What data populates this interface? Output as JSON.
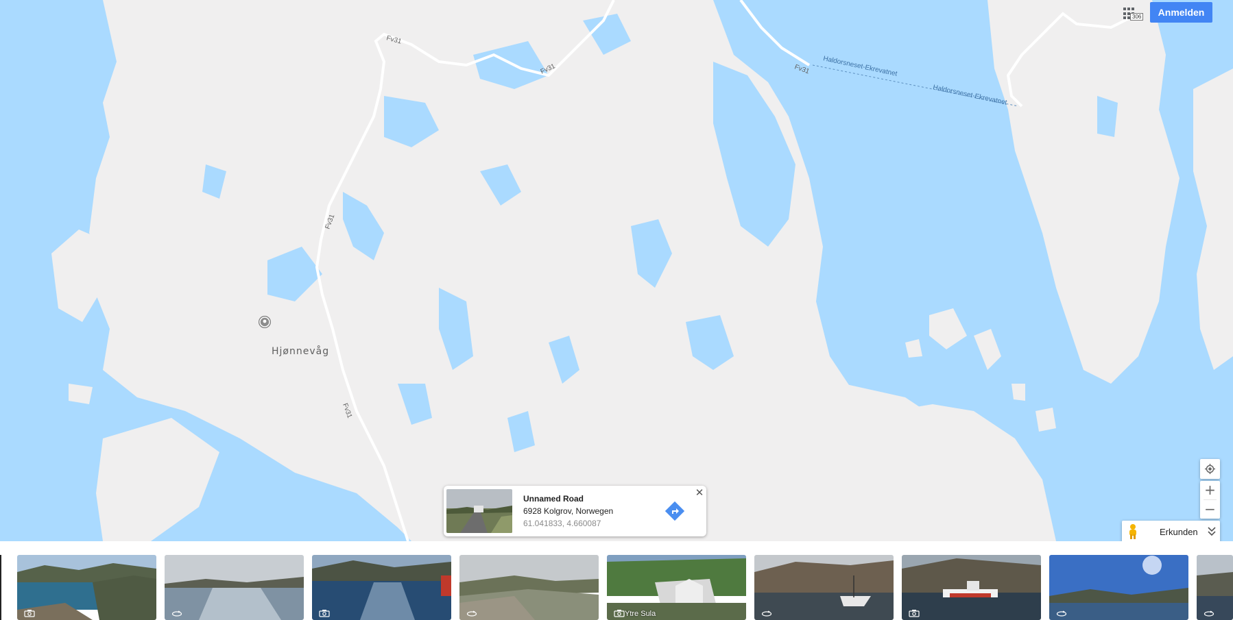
{
  "map": {
    "place_label": "Hjønnevåg",
    "road_labels": [
      "Fv31",
      "Fv31",
      "Fv31",
      "Fv31",
      "Fv31"
    ],
    "ferry_labels": [
      "Haldorsneset-Ekrevatnet",
      "Haldorsneset-Ekrevatnet"
    ],
    "water_color": "#aadaff",
    "land_color": "#f0efef",
    "road_color": "#ffffff"
  },
  "header": {
    "apps_icon": "apps-grid-icon",
    "apps_badge": "306",
    "signin_label": "Anmelden",
    "accent_color": "#4285f4"
  },
  "info_card": {
    "title": "Unnamed Road",
    "address": "6928 Kolgrov, Norwegen",
    "coords": "61.041833, 4.660087",
    "directions_icon": "directions-icon",
    "close_icon": "close-icon"
  },
  "controls": {
    "locate_icon": "my-location-icon",
    "zoom_in": "+",
    "zoom_out": "−",
    "explore_label": "Erkunden",
    "pegman_icon": "pegman-icon",
    "expand_icon": "double-chevron-down-icon"
  },
  "filmstrip": {
    "thumbnails": [
      {
        "type": "photo",
        "icon": "camera-icon",
        "label": ""
      },
      {
        "type": "360",
        "icon": "panorama-360-icon",
        "label": ""
      },
      {
        "type": "photo",
        "icon": "camera-icon",
        "label": ""
      },
      {
        "type": "360",
        "icon": "panorama-360-icon",
        "label": ""
      },
      {
        "type": "photo",
        "icon": "camera-icon",
        "label": "Ytre Sula"
      },
      {
        "type": "360",
        "icon": "panorama-360-icon",
        "label": ""
      },
      {
        "type": "photo",
        "icon": "camera-icon",
        "label": ""
      },
      {
        "type": "360",
        "icon": "panorama-360-icon",
        "label": ""
      },
      {
        "type": "360",
        "icon": "panorama-360-icon",
        "label": ""
      }
    ]
  }
}
